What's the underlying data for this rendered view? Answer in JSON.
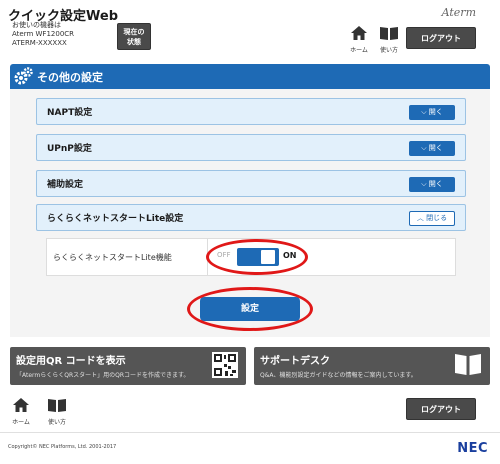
{
  "header": {
    "app_title": "クイック設定Web",
    "device_label": "お使いの機器は",
    "device_model": "Aterm WF1200CR",
    "device_id": "ATERM-XXXXXX",
    "status_button": "現在の状態",
    "brand": "Aterm",
    "nav": [
      {
        "label": "ホーム",
        "icon": "home-icon"
      },
      {
        "label": "使い方",
        "icon": "book-icon"
      }
    ],
    "logout": "ログアウト"
  },
  "section": {
    "title": "その他の設定",
    "icon": "gear-icon"
  },
  "accordions": [
    {
      "label": "NAPT設定",
      "button": "開く",
      "state": "collapsed"
    },
    {
      "label": "UPnP設定",
      "button": "開く",
      "state": "collapsed"
    },
    {
      "label": "補助設定",
      "button": "開く",
      "state": "collapsed"
    },
    {
      "label": "らくらくネットスタートLite設定",
      "button": "閉じる",
      "state": "expanded"
    }
  ],
  "setting": {
    "label": "らくらくネットスタートLite機能",
    "off_label": "OFF",
    "on_label": "ON",
    "value": "ON"
  },
  "apply_button": "設定",
  "tiles": [
    {
      "title": "設定用QR コードを表示",
      "desc": "「AtermらくらくQRスタート」用のQRコードを作成できます。",
      "icon": "qr-code-icon"
    },
    {
      "title": "サポートデスク",
      "desc": "Q&A、機能別設定ガイドなどの情報をご案内しています。",
      "icon": "book-icon"
    }
  ],
  "footer": {
    "nav": [
      {
        "label": "ホーム",
        "icon": "home-icon"
      },
      {
        "label": "使い方",
        "icon": "book-icon"
      }
    ],
    "logout": "ログアウト",
    "copyright": "Copyright© NEC Platforms, Ltd. 2001-2017",
    "logo": "NEC"
  },
  "colors": {
    "accent": "#1e6ab5",
    "accordion_bg": "#e2f0fb",
    "dark_button": "#4a4a4a",
    "highlight": "#e01818"
  }
}
